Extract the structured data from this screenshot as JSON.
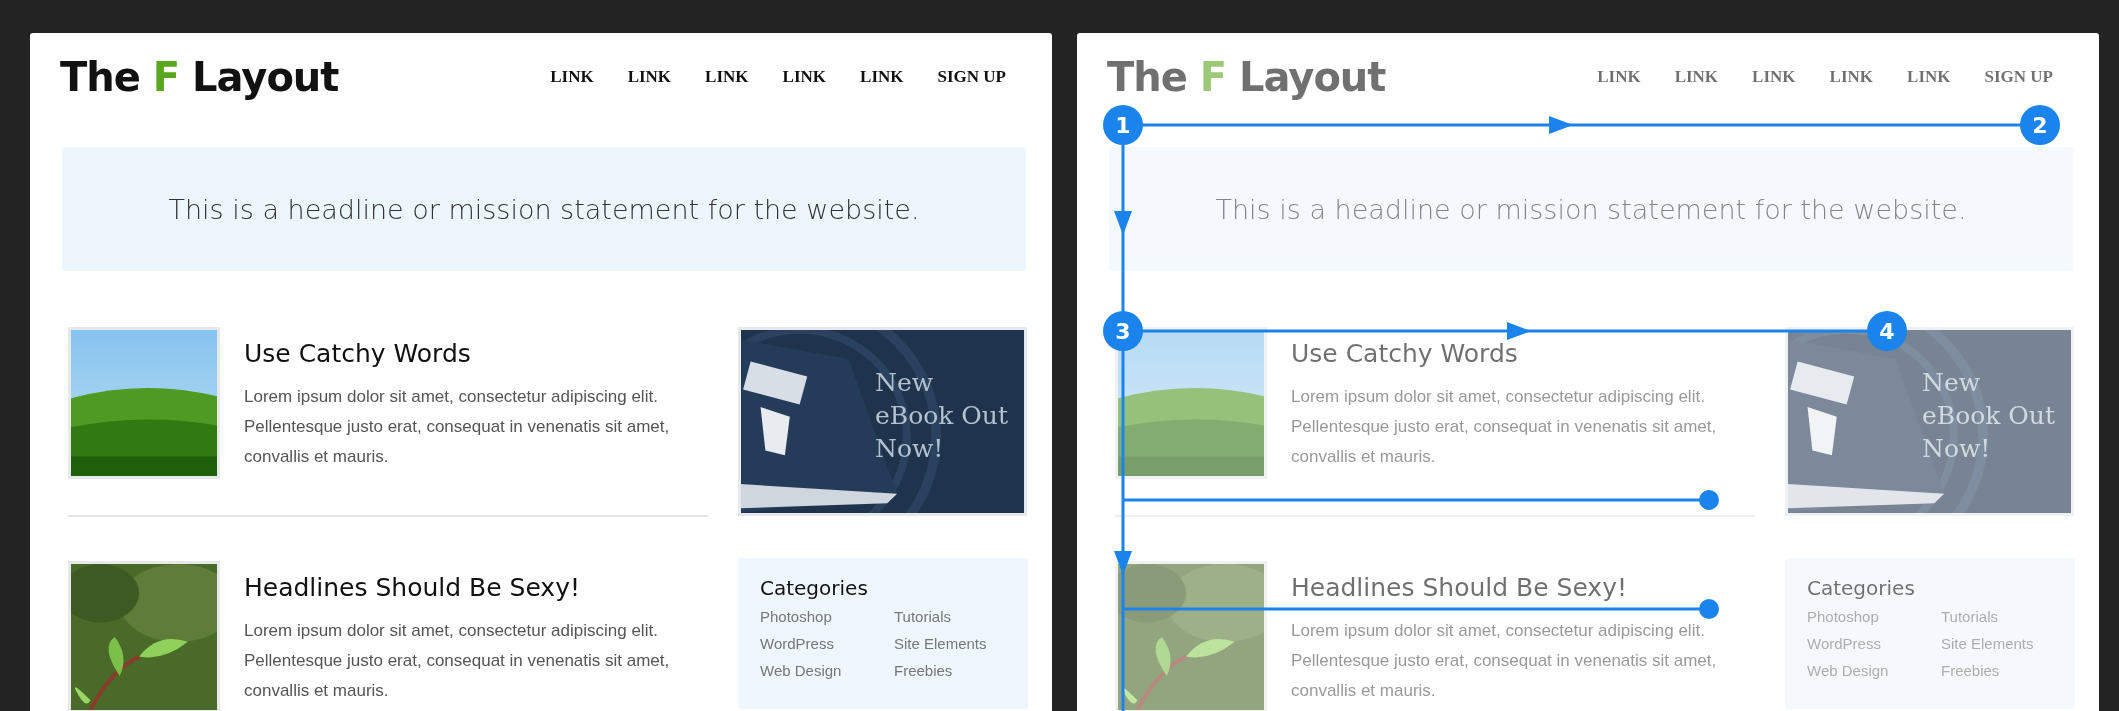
{
  "panels": [
    {
      "faded": false,
      "logo": [
        {
          "text": "The",
          "accent": false
        },
        {
          "text": "F",
          "accent": true
        },
        {
          "text": "Layout",
          "accent": false
        }
      ],
      "nav": [
        "LINK",
        "LINK",
        "LINK",
        "LINK",
        "LINK",
        "SIGN UP"
      ],
      "headline": "This is a headline or mission statement for the website.",
      "articles": [
        {
          "kind": "picture",
          "title": "Use Catchy Words",
          "body": "Lorem ipsum dolor sit amet, consectetur adipiscing elit. Pellentesque justo erat, consequat in venenatis sit amet, convallis et mauris."
        },
        {
          "kind": "picture",
          "title": "Headlines Should Be Sexy!",
          "body": "Lorem ipsum dolor sit amet, consectetur adipiscing elit. Pellentesque justo erat, consequat in venenatis sit amet, convallis et mauris."
        }
      ],
      "ad": {
        "text": "New eBook Out Now!"
      },
      "categories": {
        "title": "Categories",
        "items": [
          "Photoshop",
          "Tutorials",
          "WordPress",
          "Site Elements",
          "Web Design",
          "Freebies"
        ]
      }
    },
    {
      "faded": true,
      "logo": [
        {
          "text": "The",
          "accent": false
        },
        {
          "text": "F",
          "accent": true
        },
        {
          "text": "Layout",
          "accent": false
        }
      ],
      "nav": [
        "LINK",
        "LINK",
        "LINK",
        "LINK",
        "LINK",
        "SIGN UP"
      ],
      "headline": "This is a headline or mission statement for the website.",
      "articles": [
        {
          "kind": "picture",
          "title": "Use Catchy Words",
          "body": "Lorem ipsum dolor sit amet, consectetur adipiscing elit. Pellentesque justo erat, consequat in venenatis sit amet, convallis et mauris."
        },
        {
          "kind": "picture",
          "title": "Headlines Should Be Sexy!",
          "body": "Lorem ipsum dolor sit amet, consectetur adipiscing elit. Pellentesque justo erat, consequat in venenatis sit amet, convallis et mauris."
        }
      ],
      "ad": {
        "text": "New eBook Out Now!"
      },
      "categories": {
        "title": "Categories",
        "items": [
          "Photoshop",
          "Tutorials",
          "WordPress",
          "Site Elements",
          "Web Design",
          "Freebies"
        ]
      },
      "overlay": {
        "markers": [
          {
            "label": "1"
          },
          {
            "label": "2"
          },
          {
            "label": "3"
          },
          {
            "label": "4"
          }
        ]
      }
    }
  ]
}
